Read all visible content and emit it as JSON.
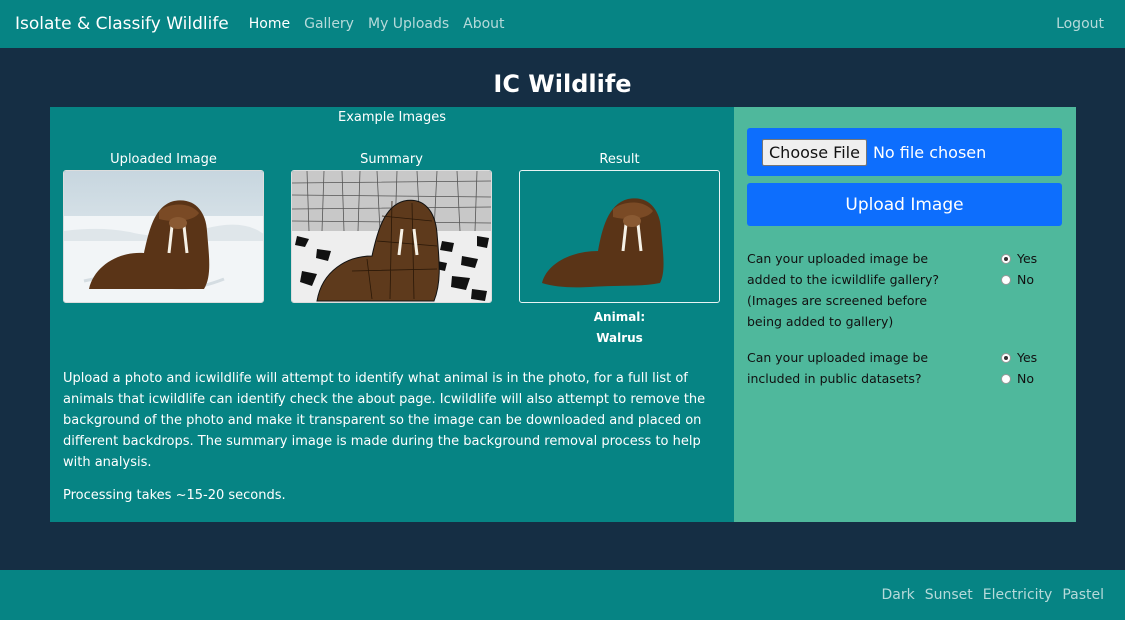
{
  "nav": {
    "brand": "Isolate & Classify Wildlife",
    "links": [
      "Home",
      "Gallery",
      "My Uploads",
      "About"
    ],
    "logout": "Logout"
  },
  "page_title": "IC Wildlife",
  "examples": {
    "title": "Example Images",
    "labels": [
      "Uploaded Image",
      "Summary",
      "Result"
    ],
    "animal_label": "Animal:",
    "animal_value": "Walrus"
  },
  "description": "Upload a photo and icwildlife will attempt to identify what animal is in the photo, for a full list of animals that icwildlife can identify check the about page. Icwildlife will also attempt to remove the background of the photo and make it transparent so the image can be downloaded and placed on different backdrops. The summary image is made during the background removal process to help with analysis.",
  "processing": "Processing takes ~15-20 seconds.",
  "upload": {
    "choose_file": "Choose File",
    "file_status": "No file chosen",
    "upload_button": "Upload Image"
  },
  "questions": [
    {
      "text": "Can your uploaded image be added to the icwildlife gallery? (Images are screened before being added to gallery)",
      "options": [
        "Yes",
        "No"
      ],
      "selected": "Yes"
    },
    {
      "text": "Can your uploaded image be included in public datasets?",
      "options": [
        "Yes",
        "No"
      ],
      "selected": "Yes"
    }
  ],
  "footer": {
    "themes": [
      "Dark",
      "Sunset",
      "Electricity",
      "Pastel"
    ]
  },
  "colors": {
    "navbar": "#068484",
    "background": "#152e44",
    "left_panel": "#068484",
    "right_panel": "#4fb89c",
    "button": "#0d6efd"
  },
  "icons": [
    "walrus-photo",
    "summary-segmentation",
    "walrus-cutout"
  ]
}
